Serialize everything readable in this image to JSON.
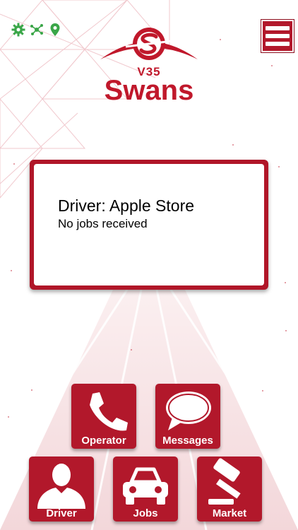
{
  "header": {
    "status_icons": [
      {
        "name": "gear-icon",
        "color": "#3aa648"
      },
      {
        "name": "network-icon",
        "color": "#3aa648"
      },
      {
        "name": "location-pin-icon",
        "color": "#3aa648"
      }
    ],
    "menu_icon": "hamburger-icon"
  },
  "logo": {
    "version": "V35",
    "brand": "Swans",
    "color": "#c0182b"
  },
  "status_panel": {
    "driver_line": "Driver: Apple Store",
    "job_status": "No jobs received"
  },
  "tiles": [
    {
      "label": "Operator",
      "icon": "phone-icon"
    },
    {
      "label": "Messages",
      "icon": "speech-bubble-icon"
    },
    {
      "label": "Driver",
      "icon": "person-icon"
    },
    {
      "label": "Jobs",
      "icon": "car-icon"
    },
    {
      "label": "Market",
      "icon": "gavel-icon"
    }
  ],
  "colors": {
    "accent": "#b2182b",
    "status_green": "#3aa648",
    "background_tint": "#f6e3e5"
  }
}
